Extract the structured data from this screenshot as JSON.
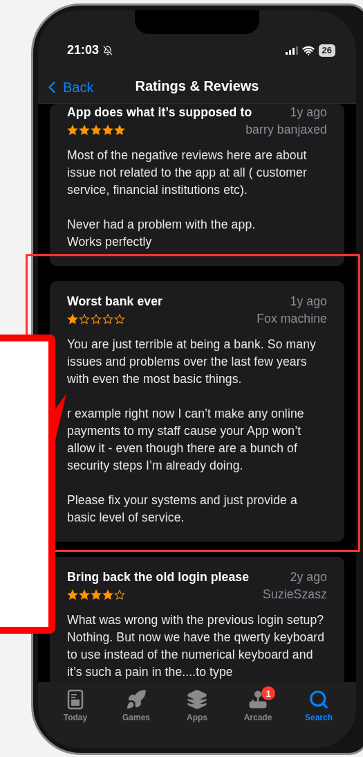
{
  "status_bar": {
    "time": "21:03",
    "battery": "26"
  },
  "nav": {
    "back": "Back",
    "title": "Ratings & Reviews"
  },
  "reviews": [
    {
      "title": "App does what it’s supposed to",
      "date": "1y ago",
      "author": "barry banjaxed",
      "stars": 5,
      "paragraphs": [
        "Most of the negative reviews here are about issue not related to the app at all ( customer service, financial institutions etc).",
        "Never had a problem with the app.\nWorks perfectly"
      ]
    },
    {
      "title": "Worst bank ever",
      "date": "1y ago",
      "author": "Fox machine",
      "stars": 1,
      "paragraphs": [
        "You are just terrible at being a bank. So many issues and problems over the last few years with even the most basic things.",
        "r example right now I can’t make any online payments to my staff cause your App won’t allow it - even though there are a bunch of security steps I’m already doing.",
        "Please fix your systems and just provide a basic level of service."
      ]
    },
    {
      "title": "Bring back the old login please",
      "date": "2y ago",
      "author": "SuzieSzasz",
      "stars": 4,
      "paragraphs": [
        "What was wrong with the previous login setup? Nothing. But now we have the qwerty keyboard to use instead of the numerical keyboard and it’s such a pain in the....to type"
      ]
    }
  ],
  "tabs": [
    {
      "kind": "today",
      "label": "Today",
      "selected": false
    },
    {
      "kind": "games",
      "label": "Games",
      "selected": false
    },
    {
      "kind": "apps",
      "label": "Apps",
      "selected": false
    },
    {
      "kind": "arcade",
      "label": "Arcade",
      "selected": false,
      "badge": "1"
    },
    {
      "kind": "search",
      "label": "Search",
      "selected": true
    }
  ]
}
